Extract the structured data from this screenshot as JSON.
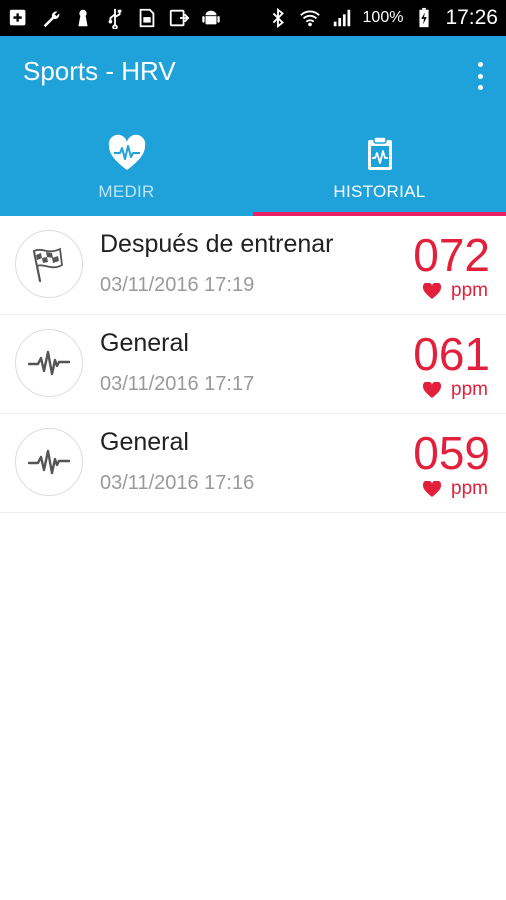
{
  "status_bar": {
    "battery": "100%",
    "time": "17:26",
    "icons_left": [
      "add-box-icon",
      "wrench-icon",
      "keyhole-icon",
      "usb-icon",
      "sim-card-icon",
      "screen-share-icon",
      "android-icon"
    ],
    "icons_right": [
      "bluetooth-icon",
      "wifi-icon",
      "signal-icon",
      "battery-charging-icon"
    ]
  },
  "app_bar": {
    "title": "Sports - HRV",
    "menu_icon": "more-vert-icon",
    "color": "#1EA2D9"
  },
  "tabs": [
    {
      "label": "MEDIR",
      "icon": "heart-pulse-icon",
      "active": false
    },
    {
      "label": "HISTORIAL",
      "icon": "clipboard-pulse-icon",
      "active": true
    }
  ],
  "tab_indicator_color": "#E91E63",
  "records": [
    {
      "title": "Después de entrenar",
      "date": "03/11/2016 17:19",
      "value": "072",
      "unit": "ppm",
      "icon": "checkered-flag-icon"
    },
    {
      "title": "General",
      "date": "03/11/2016 17:17",
      "value": "061",
      "unit": "ppm",
      "icon": "pulse-wave-icon"
    },
    {
      "title": "General",
      "date": "03/11/2016 17:16",
      "value": "059",
      "unit": "ppm",
      "icon": "pulse-wave-icon"
    }
  ],
  "accent_red": "#E3203C"
}
